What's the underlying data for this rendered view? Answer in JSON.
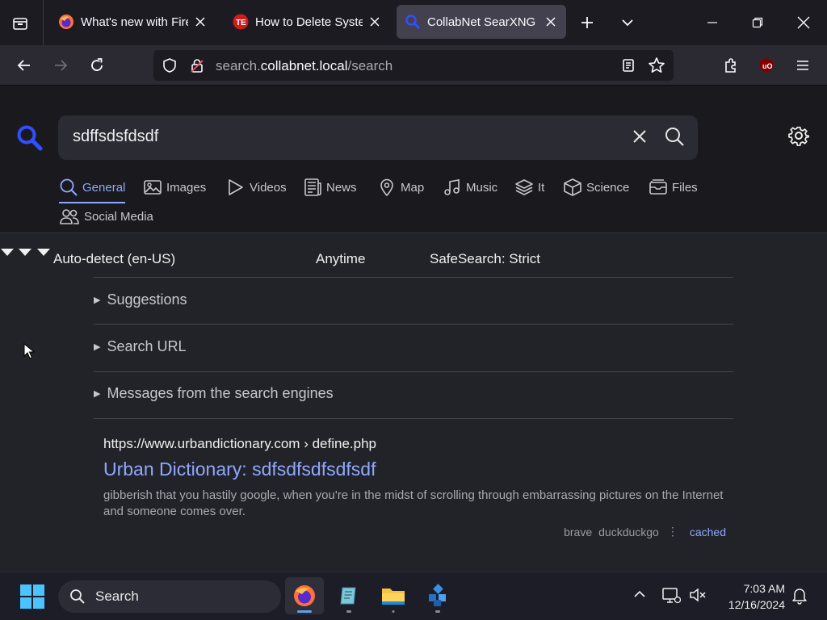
{
  "browser": {
    "tabs": [
      {
        "title": "What's new with Firef",
        "icon": "firefox-icon",
        "active": false
      },
      {
        "title": "How to Delete Systen",
        "icon": "te-site-icon",
        "active": false
      },
      {
        "title": "CollabNet SearXNG",
        "icon": "searxng-icon",
        "active": true
      }
    ],
    "url": {
      "prefix": "search.",
      "domain": "collabnet.local",
      "path": "/search"
    }
  },
  "search": {
    "query": "sdffsdsfdsdf",
    "categories": [
      {
        "label": "General",
        "icon": "search-icon",
        "active": true
      },
      {
        "label": "Images",
        "icon": "image-icon"
      },
      {
        "label": "Videos",
        "icon": "play-icon"
      },
      {
        "label": "News",
        "icon": "newspaper-icon"
      },
      {
        "label": "Map",
        "icon": "map-pin-icon"
      },
      {
        "label": "Music",
        "icon": "music-icon"
      },
      {
        "label": "It",
        "icon": "layers-icon"
      },
      {
        "label": "Science",
        "icon": "cube-icon"
      },
      {
        "label": "Files",
        "icon": "files-icon"
      },
      {
        "label": "Social Media",
        "icon": "people-icon"
      }
    ],
    "filters": {
      "language": "Auto-detect (en-US)",
      "time": "Anytime",
      "safesearch": "SafeSearch: Strict"
    },
    "sections": [
      "Suggestions",
      "Search URL",
      "Messages from the search engines"
    ]
  },
  "results": [
    {
      "url_host": "https://www.urbandictionary.com",
      "url_path": "› define.php",
      "title": "Urban Dictionary: sdfsdfsdfsdfsdf",
      "snippet": "gibberish that you hastily google, when you're in the midst of scrolling through embarrassing pictures on the Internet and someone comes over.",
      "engines": [
        "brave",
        "duckduckgo"
      ],
      "cached_label": "cached"
    }
  ],
  "taskbar": {
    "search_label": "Search",
    "time": "7:03 AM",
    "date": "12/16/2024"
  },
  "colors": {
    "accent": "#8ea8ff",
    "page_bg": "#222328",
    "header_bg": "#1a1a1e"
  }
}
